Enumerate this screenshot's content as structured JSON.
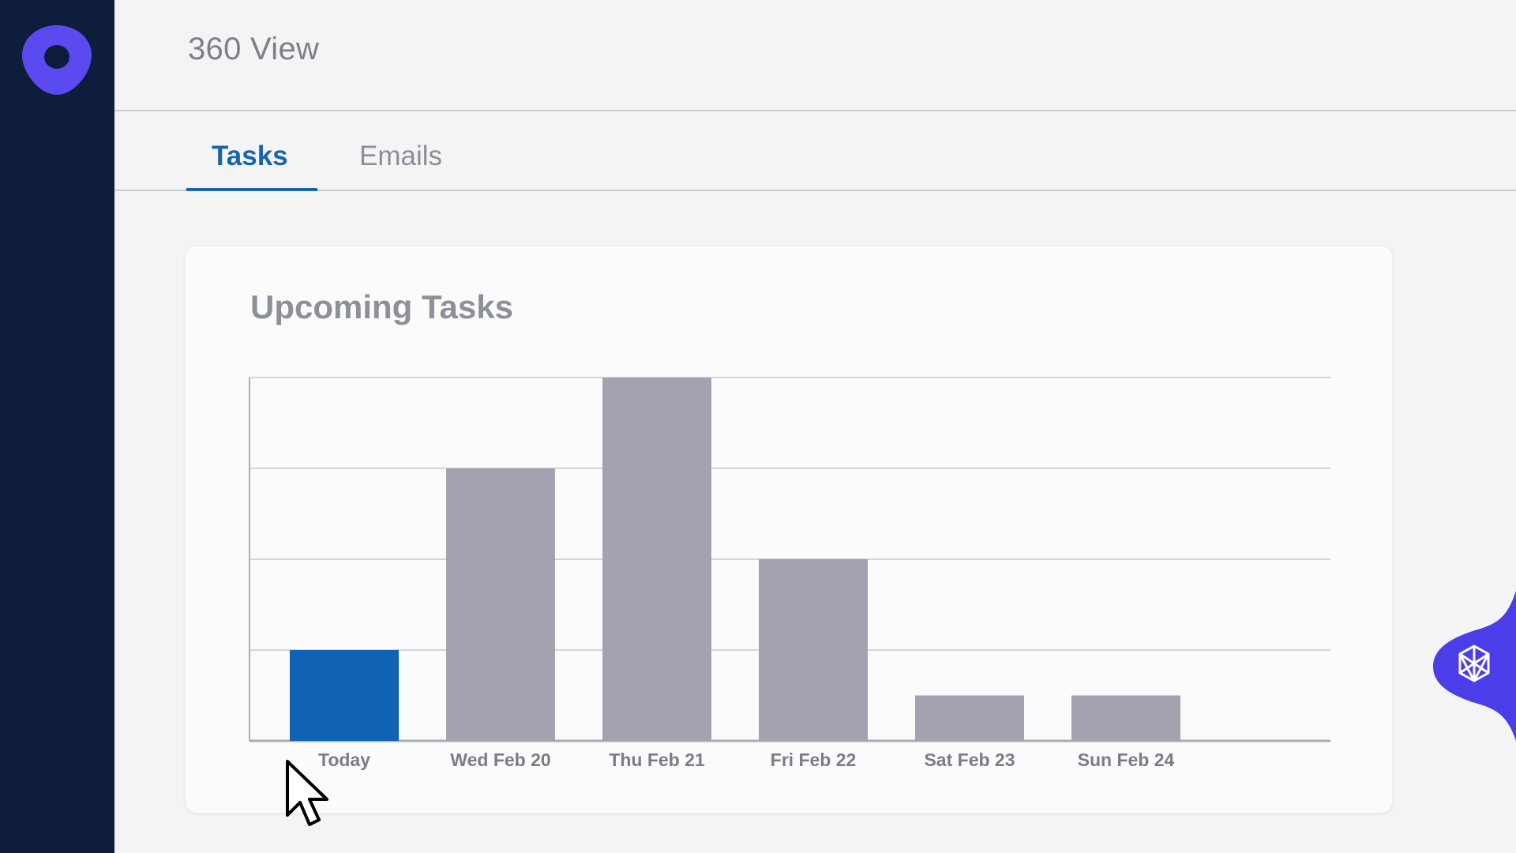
{
  "header": {
    "title": "360 View"
  },
  "tabs": [
    {
      "label": "Tasks",
      "active": true
    },
    {
      "label": "Emails",
      "active": false
    }
  ],
  "card": {
    "title": "Upcoming Tasks"
  },
  "icons": {
    "logo": "outreach-logo-icon",
    "assistant": "network-icon",
    "cursor": "mouse-pointer-icon"
  },
  "colors": {
    "rail": "#0e1d3b",
    "accent": "#1a63ad",
    "bar_default": "#a3a3b0",
    "bar_highlight": "#0f62b4",
    "logo": "#5b4af0"
  },
  "chart_data": {
    "type": "bar",
    "categories": [
      "Today",
      "Wed Feb 20",
      "Thu Feb 21",
      "Fri Feb 22",
      "Sat Feb 23",
      "Sun Feb 24"
    ],
    "values": [
      1,
      3,
      4,
      2,
      0.5,
      0.5
    ],
    "highlight_index": 0,
    "ylim": [
      0,
      4
    ],
    "grid": true
  }
}
